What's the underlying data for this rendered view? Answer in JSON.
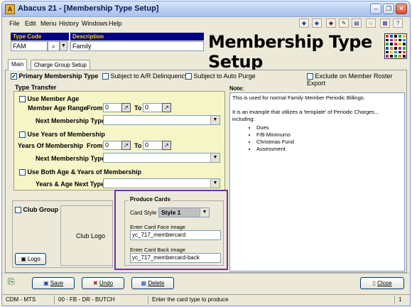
{
  "window": {
    "title": "Abacus 21 - [Membership Type Setup]",
    "app_icon_glyph": "A"
  },
  "menu": {
    "items": [
      "File",
      "Edit",
      "Menu",
      "History",
      "Windows",
      "Help"
    ]
  },
  "header": {
    "type_code_label": "Type Code",
    "type_code_value": "FAM",
    "description_label": "Description",
    "description_value": "Family",
    "page_title": "Membership Type Setup"
  },
  "tabs": [
    "Main",
    "Charge Group Setup"
  ],
  "options": {
    "primary_membership_type": {
      "label": "Primary Membership Type",
      "checked": true
    },
    "subject_ar_delinquency": {
      "label": "Subject to A/R Delinquency",
      "checked": false
    },
    "subject_auto_purge": {
      "label": "Subject to Auto Purge",
      "checked": false
    },
    "exclude_roster": {
      "label": "Exclude on Member Roster Export",
      "checked": false
    }
  },
  "type_transfer": {
    "legend": "Type Transfer",
    "use_member_age": "Use Member Age",
    "member_age_range": "Member Age Range",
    "from_label": "From",
    "to_label": "To",
    "age_from": "0",
    "age_to": "0",
    "next_membership_type": "Next Membership Type",
    "use_years": "Use Years of Membership",
    "years_of_membership": "Years Of Membership",
    "years_from": "0",
    "years_to": "0",
    "next_membership_type_2": "Next Membership Type",
    "use_both": "Use Both Age & Years of Membership",
    "years_age_next": "Years & Age Next Type"
  },
  "note": {
    "label": "Note:",
    "line1": "This is used for normal Family Member Periodic Billings.",
    "line2": "It is an example that utilizes a 'template' of Periodic Charges... including:",
    "items": [
      "Dues",
      "F/B Minimums",
      "Christmas Fund",
      "Assessment"
    ]
  },
  "club": {
    "club_group_label": "Club Group",
    "club_logo_label": "Club Logo",
    "logo_button": "Logo"
  },
  "produce_cards": {
    "legend": "Produce Cards",
    "card_style_label": "Card Style",
    "card_style_value": "Style 1",
    "face_label": "Enter Card Face Image",
    "face_value": "yc_717_membercard",
    "back_label": "Enter Card Back Image",
    "back_value": "yc_717_membercard-back"
  },
  "buttons": {
    "save": "Save",
    "undo": "Undo",
    "delete": "Delete",
    "close": "Close"
  },
  "status": {
    "company": "CDM - MTS",
    "user": "00 - FB - DR - BUTCH",
    "message": "Enter the card type to produce",
    "page": "1"
  },
  "colors": {
    "header_label_bg": "#000080",
    "header_label_fg": "#ffd800",
    "type_transfer_bg": "#f5f5c8",
    "produce_cards_border": "#7030a0"
  }
}
